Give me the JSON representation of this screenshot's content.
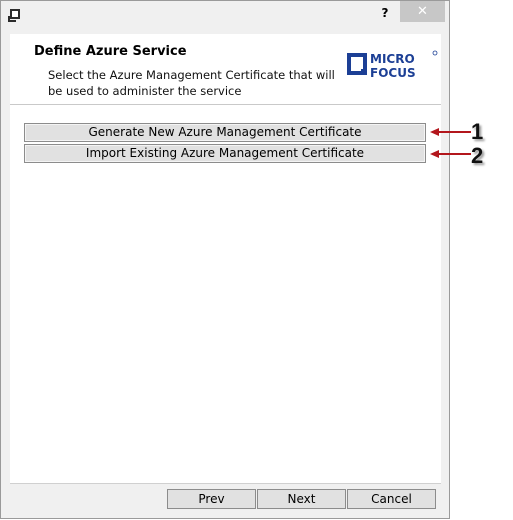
{
  "window": {
    "help_label": "?",
    "close_label": "✕"
  },
  "header": {
    "title": "Define Azure Service",
    "description": "Select the Azure Management Certificate that will be used to administer the service",
    "logo_line1": "MICRO",
    "logo_line2": "FOCUS"
  },
  "options": [
    {
      "label": "Generate New Azure Management Certificate",
      "callout": "1"
    },
    {
      "label": "Import Existing Azure Management Certificate",
      "callout": "2"
    }
  ],
  "footer": {
    "prev_label": "Prev",
    "next_label": "Next",
    "cancel_label": "Cancel"
  },
  "colors": {
    "callout_arrow": "#b3161c",
    "logo_blue": "#1c3f95"
  }
}
